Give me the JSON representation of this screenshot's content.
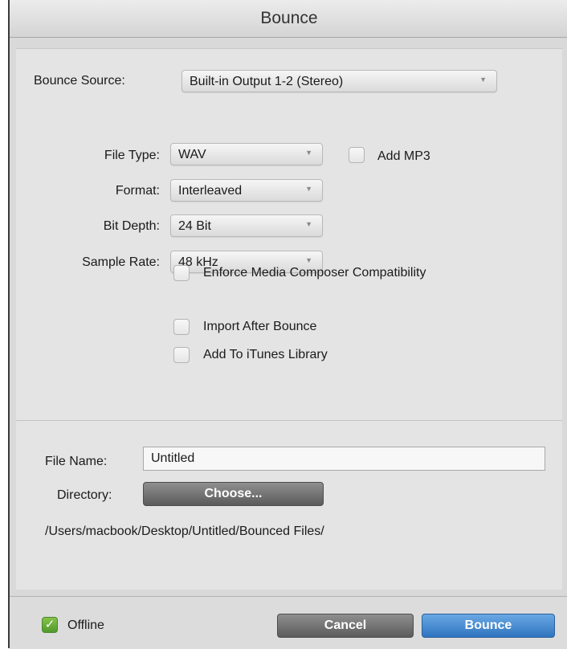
{
  "window": {
    "title": "Bounce"
  },
  "source": {
    "label": "Bounce Source:",
    "value": "Built-in Output 1-2 (Stereo)"
  },
  "format_settings": {
    "file_type": {
      "label": "File Type:",
      "value": "WAV"
    },
    "add_mp3": {
      "label": "Add MP3",
      "checked": false
    },
    "format": {
      "label": "Format:",
      "value": "Interleaved"
    },
    "bit_depth": {
      "label": "Bit Depth:",
      "value": "24 Bit"
    },
    "sample_rate": {
      "label": "Sample Rate:",
      "value": "48 kHz"
    },
    "options": [
      {
        "label": "Enforce Media Composer Compatibility",
        "checked": false
      },
      {
        "label": "Import After Bounce",
        "checked": false
      },
      {
        "label": "Add To iTunes Library",
        "checked": false
      }
    ]
  },
  "file": {
    "name_label": "File Name:",
    "name_value": "Untitled",
    "directory_label": "Directory:",
    "choose_label": "Choose...",
    "path": "/Users/macbook/Desktop/Untitled/Bounced Files/"
  },
  "footer": {
    "offline_label": "Offline",
    "offline_checked": true,
    "cancel_label": "Cancel",
    "bounce_label": "Bounce"
  },
  "icons": {
    "dropdown": "chevron-down-icon",
    "check": "checkmark-icon"
  },
  "colors": {
    "primary_button": "#3a7ec8",
    "secondary_button": "#6e6e6e",
    "checkbox_checked": "#5fa836"
  }
}
